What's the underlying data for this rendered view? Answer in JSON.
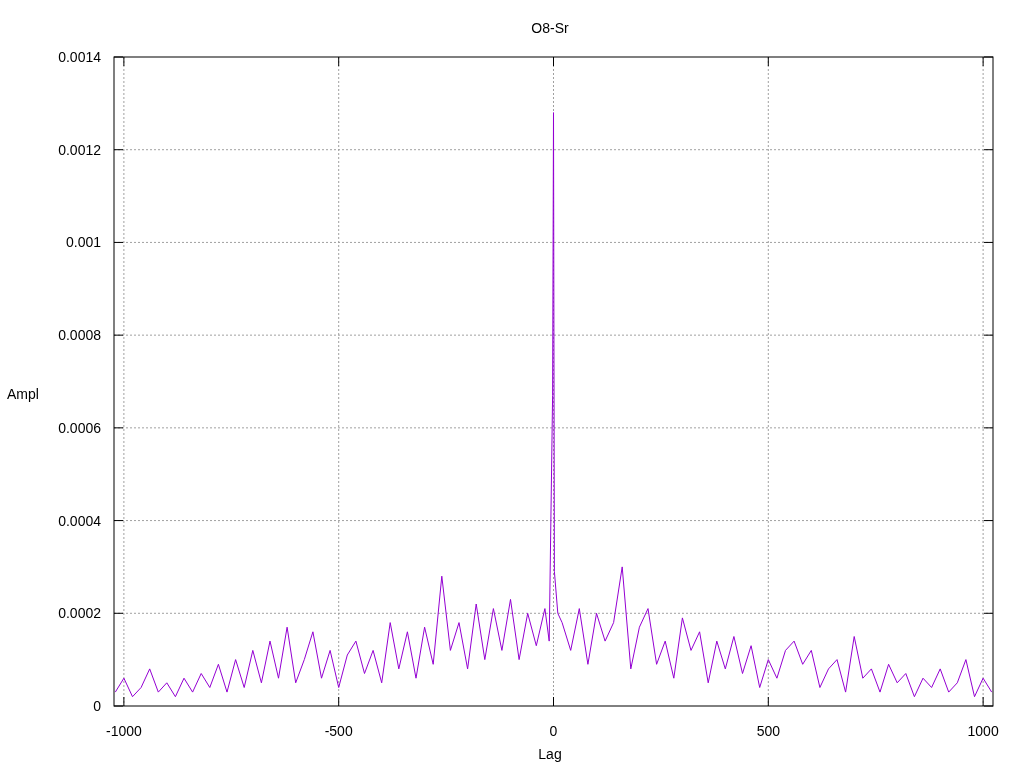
{
  "chart": {
    "chart_data": {
      "type": "line",
      "title": "O8-Sr",
      "xlabel": "Lag",
      "ylabel": "Ampl",
      "grid": true,
      "xlim": [
        -1023,
        1023
      ],
      "ylim": [
        0,
        0.0014
      ],
      "xticks": [
        -1000,
        -500,
        0,
        500,
        1000
      ],
      "yticks": [
        0,
        0.0002,
        0.0004,
        0.0006,
        0.0008,
        0.001,
        0.0012,
        0.0014
      ],
      "x": [
        -1020,
        -1000,
        -980,
        -960,
        -940,
        -920,
        -900,
        -880,
        -860,
        -840,
        -820,
        -800,
        -780,
        -760,
        -740,
        -720,
        -700,
        -680,
        -660,
        -640,
        -620,
        -600,
        -580,
        -560,
        -540,
        -520,
        -500,
        -480,
        -460,
        -440,
        -420,
        -400,
        -380,
        -360,
        -340,
        -320,
        -300,
        -280,
        -260,
        -240,
        -220,
        -200,
        -180,
        -160,
        -140,
        -120,
        -100,
        -80,
        -60,
        -40,
        -20,
        -10,
        -2,
        0,
        2,
        10,
        20,
        40,
        60,
        80,
        100,
        120,
        140,
        160,
        180,
        200,
        220,
        240,
        260,
        280,
        300,
        320,
        340,
        360,
        380,
        400,
        420,
        440,
        460,
        480,
        500,
        520,
        540,
        560,
        580,
        600,
        620,
        640,
        660,
        680,
        700,
        720,
        740,
        760,
        780,
        800,
        820,
        840,
        860,
        880,
        900,
        920,
        940,
        960,
        980,
        1000,
        1020
      ],
      "series": [
        {
          "color": "#9400d3",
          "values": [
            3e-05,
            6e-05,
            2e-05,
            4e-05,
            8e-05,
            3e-05,
            5e-05,
            2e-05,
            6e-05,
            3e-05,
            7e-05,
            4e-05,
            9e-05,
            3e-05,
            0.0001,
            4e-05,
            0.00012,
            5e-05,
            0.00014,
            6e-05,
            0.00017,
            5e-05,
            0.0001,
            0.00016,
            6e-05,
            0.00012,
            4e-05,
            0.00011,
            0.00014,
            7e-05,
            0.00012,
            5e-05,
            0.00018,
            8e-05,
            0.00016,
            6e-05,
            0.00017,
            9e-05,
            0.00028,
            0.00012,
            0.00018,
            8e-05,
            0.00022,
            0.0001,
            0.00021,
            0.00012,
            0.00023,
            0.0001,
            0.0002,
            0.00013,
            0.00021,
            0.00014,
            0.00067,
            0.00128,
            0.00029,
            0.0002,
            0.00018,
            0.00012,
            0.00021,
            9e-05,
            0.0002,
            0.00014,
            0.00018,
            0.0003,
            8e-05,
            0.00017,
            0.00021,
            9e-05,
            0.00014,
            6e-05,
            0.00019,
            0.00012,
            0.00016,
            5e-05,
            0.00014,
            8e-05,
            0.00015,
            7e-05,
            0.00013,
            4e-05,
            0.0001,
            6e-05,
            0.00012,
            0.00014,
            9e-05,
            0.00012,
            4e-05,
            8e-05,
            0.0001,
            3e-05,
            0.00015,
            6e-05,
            8e-05,
            3e-05,
            9e-05,
            5e-05,
            7e-05,
            2e-05,
            6e-05,
            4e-05,
            8e-05,
            3e-05,
            5e-05,
            0.0001,
            2e-05,
            6e-05,
            3e-05
          ]
        }
      ]
    }
  }
}
